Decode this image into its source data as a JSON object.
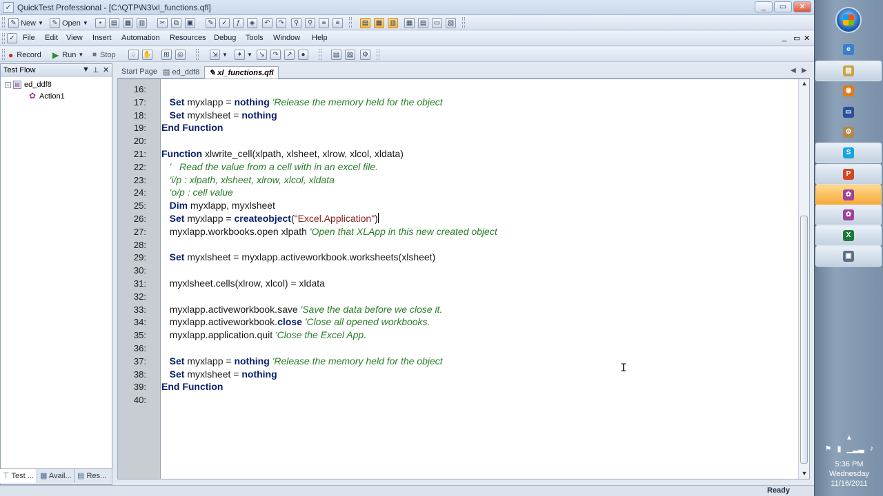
{
  "window": {
    "title": "QuickTest Professional - [C:\\QTP\\N3\\xl_functions.qfl]",
    "controls": [
      "_",
      "▭",
      "✕"
    ],
    "mdi_controls": [
      "_",
      "▭",
      "✕"
    ]
  },
  "toolbar1": {
    "new_label": "New",
    "open_label": "Open"
  },
  "menu": [
    "File",
    "Edit",
    "View",
    "Insert",
    "Automation",
    "Resources",
    "Debug",
    "Tools",
    "Window",
    "Help"
  ],
  "toolbar3": {
    "record_label": "Record",
    "run_label": "Run",
    "stop_label": "Stop"
  },
  "test_flow": {
    "title": "Test Flow",
    "controls": [
      "▼",
      "✕"
    ],
    "root": "ed_ddf8",
    "child": "Action1",
    "bottom_tabs": [
      "Test ...",
      "Avail...",
      "Res..."
    ]
  },
  "doc_tabs": {
    "tabs": [
      "Start Page",
      "ed_ddf8",
      "xl_functions.qfl"
    ],
    "active": "xl_functions.qfl"
  },
  "code": {
    "lines": [
      {
        "n": "16:",
        "parts": []
      },
      {
        "n": "17:",
        "parts": [
          {
            "t": "   "
          },
          {
            "t": "Set",
            "c": "kw"
          },
          {
            "t": " myxlapp = "
          },
          {
            "t": "nothing",
            "c": "kw"
          },
          {
            "t": " "
          },
          {
            "t": "'Release the memory held for the object",
            "c": "cm"
          }
        ]
      },
      {
        "n": "18:",
        "parts": [
          {
            "t": "   "
          },
          {
            "t": "Set",
            "c": "kw"
          },
          {
            "t": " myxlsheet = "
          },
          {
            "t": "nothing",
            "c": "kw"
          }
        ]
      },
      {
        "n": "19:",
        "parts": [
          {
            "t": "End Function",
            "c": "kw"
          }
        ]
      },
      {
        "n": "20:",
        "parts": []
      },
      {
        "n": "21:",
        "parts": [
          {
            "t": "Function",
            "c": "kw"
          },
          {
            "t": " xlwrite_cell(xlpath, xlsheet, xlrow, xlcol, xldata)"
          }
        ]
      },
      {
        "n": "22:",
        "parts": [
          {
            "t": "   "
          },
          {
            "t": "'   Read the value from a cell with in an excel file.",
            "c": "cm"
          }
        ]
      },
      {
        "n": "23:",
        "parts": [
          {
            "t": "   "
          },
          {
            "t": "'i/p : xlpath, xlsheet, xlrow, xlcol, xldata",
            "c": "cm"
          }
        ]
      },
      {
        "n": "24:",
        "parts": [
          {
            "t": "   "
          },
          {
            "t": "'o/p : cell value",
            "c": "cm"
          }
        ]
      },
      {
        "n": "25:",
        "parts": [
          {
            "t": "   "
          },
          {
            "t": "Dim",
            "c": "kw"
          },
          {
            "t": " myxlapp, myxlsheet"
          }
        ]
      },
      {
        "n": "26:",
        "parts": [
          {
            "t": "   "
          },
          {
            "t": "Set",
            "c": "kw"
          },
          {
            "t": " myxlapp = "
          },
          {
            "t": "createobject",
            "c": "kw"
          },
          {
            "t": "("
          },
          {
            "t": "\"Excel.Application\"",
            "c": "st"
          },
          {
            "t": ")"
          },
          {
            "caret": true
          }
        ]
      },
      {
        "n": "27:",
        "parts": [
          {
            "t": "   myxlapp.workbooks.open xlpath "
          },
          {
            "t": "'Open that XLApp in this new created object",
            "c": "cm"
          }
        ]
      },
      {
        "n": "28:",
        "parts": []
      },
      {
        "n": "29:",
        "parts": [
          {
            "t": "   "
          },
          {
            "t": "Set",
            "c": "kw"
          },
          {
            "t": " myxlsheet = myxlapp.activeworkbook.worksheets(xlsheet)"
          }
        ]
      },
      {
        "n": "30:",
        "parts": []
      },
      {
        "n": "31:",
        "parts": [
          {
            "t": "   myxlsheet.cells(xlrow, xlcol) = xldata"
          }
        ]
      },
      {
        "n": "32:",
        "parts": []
      },
      {
        "n": "33:",
        "parts": [
          {
            "t": "   myxlapp.activeworkbook.save "
          },
          {
            "t": "'Save the data before we close it.",
            "c": "cm"
          }
        ]
      },
      {
        "n": "34:",
        "parts": [
          {
            "t": "   myxlapp.activeworkbook."
          },
          {
            "t": "close",
            "c": "kw"
          },
          {
            "t": " "
          },
          {
            "t": "'Close all opened workbooks.",
            "c": "cm"
          }
        ]
      },
      {
        "n": "35:",
        "parts": [
          {
            "t": "   myxlapp.application.quit "
          },
          {
            "t": "'Close the Excel App.",
            "c": "cm"
          }
        ]
      },
      {
        "n": "36:",
        "parts": []
      },
      {
        "n": "37:",
        "parts": [
          {
            "t": "   "
          },
          {
            "t": "Set",
            "c": "kw"
          },
          {
            "t": " myxlapp = "
          },
          {
            "t": "nothing",
            "c": "kw"
          },
          {
            "t": " "
          },
          {
            "t": "'Release the memory held for the object",
            "c": "cm"
          }
        ]
      },
      {
        "n": "38:",
        "parts": [
          {
            "t": "   "
          },
          {
            "t": "Set",
            "c": "kw"
          },
          {
            "t": " myxlsheet = "
          },
          {
            "t": "nothing",
            "c": "kw"
          }
        ]
      },
      {
        "n": "39:",
        "parts": [
          {
            "t": "End Function",
            "c": "kw"
          }
        ]
      },
      {
        "n": "40:",
        "parts": []
      }
    ]
  },
  "status": {
    "text": "Ready"
  },
  "taskbar": {
    "apps": [
      {
        "name": "internet-explorer-icon",
        "glyph": "e",
        "color": "#3a7fd0",
        "style": "plain"
      },
      {
        "name": "file-explorer-icon",
        "glyph": "▤",
        "color": "#c9a44a",
        "style": "boxed"
      },
      {
        "name": "media-player-icon",
        "glyph": "◉",
        "color": "#e07a1a",
        "style": "plain"
      },
      {
        "name": "window-icon",
        "glyph": "▭",
        "color": "#2b4f9a",
        "style": "plain"
      },
      {
        "name": "settings-icon",
        "glyph": "⚙",
        "color": "#b0894a",
        "style": "plain"
      },
      {
        "name": "skype-icon",
        "glyph": "S",
        "color": "#1aa3e0",
        "style": "boxed"
      },
      {
        "name": "powerpoint-icon",
        "glyph": "P",
        "color": "#d24726",
        "style": "boxed"
      },
      {
        "name": "qtp-icon",
        "glyph": "✿",
        "color": "#a0409a",
        "style": "active"
      },
      {
        "name": "qtp-secondary-icon",
        "glyph": "✿",
        "color": "#a0409a",
        "style": "boxed"
      },
      {
        "name": "excel-icon",
        "glyph": "X",
        "color": "#1d7a3a",
        "style": "boxed"
      },
      {
        "name": "remote-desktop-icon",
        "glyph": "▣",
        "color": "#5a6f88",
        "style": "boxed"
      }
    ],
    "clock": {
      "time": "5:36 PM",
      "day": "Wednesday",
      "date": "11/16/2011"
    }
  }
}
